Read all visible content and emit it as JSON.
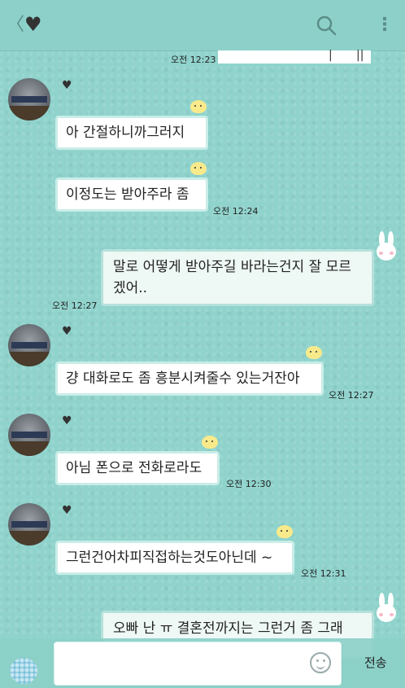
{
  "header": {
    "back_glyph": "〈",
    "chat_title": "♥",
    "more_glyph": "⋮"
  },
  "messages": [
    {
      "text": "아 간절하니까그러지"
    },
    {
      "text": "이정도는 받아주라 좀",
      "time": "오전 12:24"
    },
    {
      "text": "말로 어떻게 받아주길 바라는건지 잘 모르겠어..",
      "time": "오전 12:27"
    },
    {
      "text": "걍 대화로도 좀 흥분시켜줄수 있는거잔아",
      "time": "오전 12:27"
    },
    {
      "text": "아님 폰으로 전화로라도",
      "time": "오전 12:30"
    },
    {
      "text": "그런건어차피직접하는것도아닌데 ~",
      "time": "오전 12:31"
    },
    {
      "text": "오빠 난 ㅠ 결혼전까지는 그런거 좀 그래"
    }
  ],
  "top_time": "오전 12:23",
  "sender_heart": "♥",
  "composer": {
    "input_value": "",
    "send_label": "전송"
  },
  "colors": {
    "background": "#8fd3cc",
    "bubble_border": "#c9ede8",
    "outgoing_bubble": "#eef8f5"
  },
  "icons": [
    "back-icon",
    "search-icon",
    "more-icon",
    "emoji-icon",
    "plus-icon",
    "chick-sticker-icon",
    "bunny-sticker-icon"
  ]
}
